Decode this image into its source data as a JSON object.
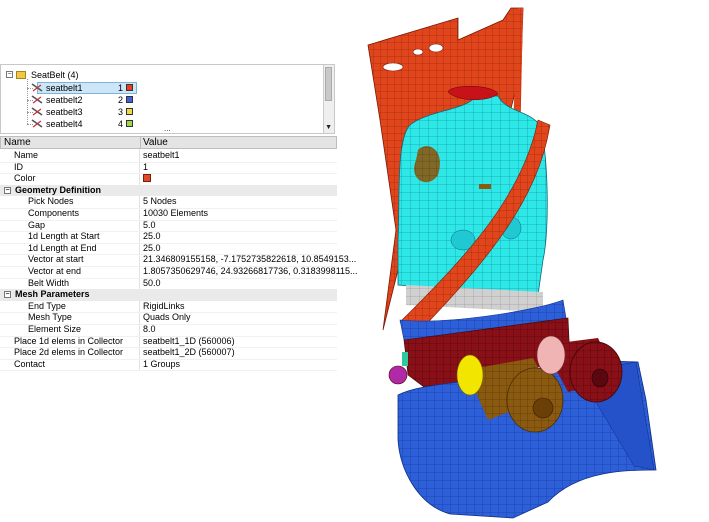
{
  "tree": {
    "parent": {
      "label": "SeatBelt (4)"
    },
    "items": [
      {
        "label": "seatbelt1",
        "index": "1",
        "color": "#e8401c",
        "selected": true
      },
      {
        "label": "seatbelt2",
        "index": "2",
        "color": "#3b62d8",
        "selected": false
      },
      {
        "label": "seatbelt3",
        "index": "3",
        "color": "#f1d84a",
        "selected": false
      },
      {
        "label": "seatbelt4",
        "index": "4",
        "color": "#9dd840",
        "selected": false
      }
    ],
    "more": "..."
  },
  "grid": {
    "header": {
      "name": "Name",
      "value": "Value"
    },
    "general": [
      {
        "name": "Name",
        "value": "seatbelt1"
      },
      {
        "name": "ID",
        "value": "1"
      },
      {
        "name": "Color",
        "value": "",
        "color": "#e04a2a"
      }
    ],
    "geometry": {
      "title": "Geometry Definition",
      "rows": [
        {
          "name": "Pick Nodes",
          "value": "5 Nodes"
        },
        {
          "name": "Components",
          "value": "10030 Elements"
        },
        {
          "name": "Gap",
          "value": "5.0"
        },
        {
          "name": "1d Length at Start",
          "value": "25.0"
        },
        {
          "name": "1d Length at End",
          "value": "25.0"
        },
        {
          "name": "Vector at start",
          "value": "21.346809155158, -7.1752735822618, 10.8549153..."
        },
        {
          "name": "Vector at end",
          "value": "1.8057350629746, 24.93266817736, 0.3183998115..."
        },
        {
          "name": "Belt Width",
          "value": "50.0"
        }
      ]
    },
    "mesh": {
      "title": "Mesh Parameters",
      "rows": [
        {
          "name": "End Type",
          "value": "RigidLinks"
        },
        {
          "name": "Mesh Type",
          "value": "Quads Only"
        },
        {
          "name": "Element Size",
          "value": "8.0"
        }
      ]
    },
    "collectors": [
      {
        "name": "Place 1d elems in Collector",
        "value": "seatbelt1_1D (560006)"
      },
      {
        "name": "Place 2d elems in Collector",
        "value": "seatbelt1_2D (560007)"
      },
      {
        "name": "Contact",
        "value": "1 Groups"
      }
    ]
  },
  "viewport": {
    "colors": {
      "seat": "#e0451c",
      "dummy": "#2ee8e8",
      "belt": "#e0451c",
      "base": "#2d5fd8",
      "leg": "#8a5a10",
      "lap": "#2c4fb8"
    }
  }
}
